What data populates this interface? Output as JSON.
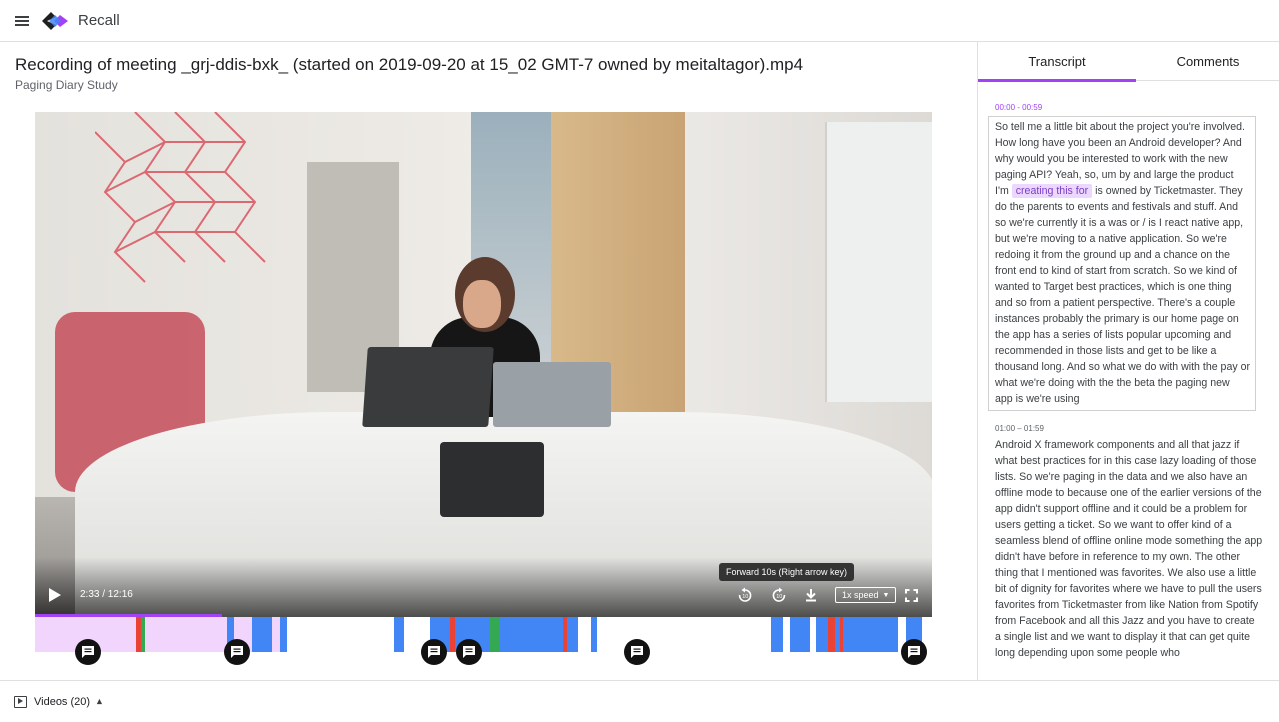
{
  "app": {
    "name": "Recall"
  },
  "recording": {
    "title": "Recording of meeting _grj-ddis-bxk_ (started on 2019-09-20 at 15_02 GMT-7 owned by meitaltagor).mp4",
    "study": "Paging Diary Study"
  },
  "player": {
    "time": "2:33 / 12:16",
    "speed_label": "1x speed",
    "tooltip": "Forward 10s (Right arrow key)",
    "progress": 0.208,
    "icons": [
      "play-icon",
      "rewind-10-icon",
      "forward-10-icon",
      "download-icon",
      "fullscreen-icon"
    ]
  },
  "tabs": [
    {
      "label": "Transcript",
      "active": true
    },
    {
      "label": "Comments",
      "active": false
    }
  ],
  "transcript": [
    {
      "time": "00:00 - 00:59",
      "before": "So tell me a little bit about the project you're involved. How long have you been an Android developer? And why would you be interested to work with the new paging API? Yeah, so, um by and large the product I'm ",
      "highlight": "creating this for",
      "after": " is owned by Ticketmaster. They do the parents to events and festivals and stuff. And so we're currently it is a was or / is I react native app, but we're moving to a native application. So we're redoing it from the ground up and a chance on the front end to kind of start from scratch. So we kind of wanted to Target best practices, which is one thing and so from a patient perspective. There's a couple instances probably the primary is our home page on the app has a series of lists popular upcoming and recommended in those lists and get to be like a thousand long. And so what we do with with the pay or what we're doing with the the beta the paging new app is we're using"
    },
    {
      "time": "01:00 – 01:59",
      "text": "Android X framework components and all that jazz if what best practices for in this case lazy loading of those lists. So we're paging in the data and we also have an offline mode to because one of the earlier versions of the app didn't support offline and it could be a problem for users getting a ticket. So we want to offer kind of a seamless blend of offline online mode something the app didn't have before in reference to my own. The other thing that I mentioned was favorites. We also use a little bit of dignity for favorites where we have to pull the users favorites from Ticketmaster from like Nation from Spotify from Facebook and all this Jazz and you have to create a single list and we want to display it that can get quite long depending upon some people who"
    }
  ],
  "footer": {
    "videos_label": "Videos (20)"
  },
  "colors": {
    "accent": "#a142f4",
    "segment_light": "#f1d5fc",
    "segment_blue": "#4285f4",
    "segment_red": "#ea4335",
    "segment_green": "#34a853"
  }
}
